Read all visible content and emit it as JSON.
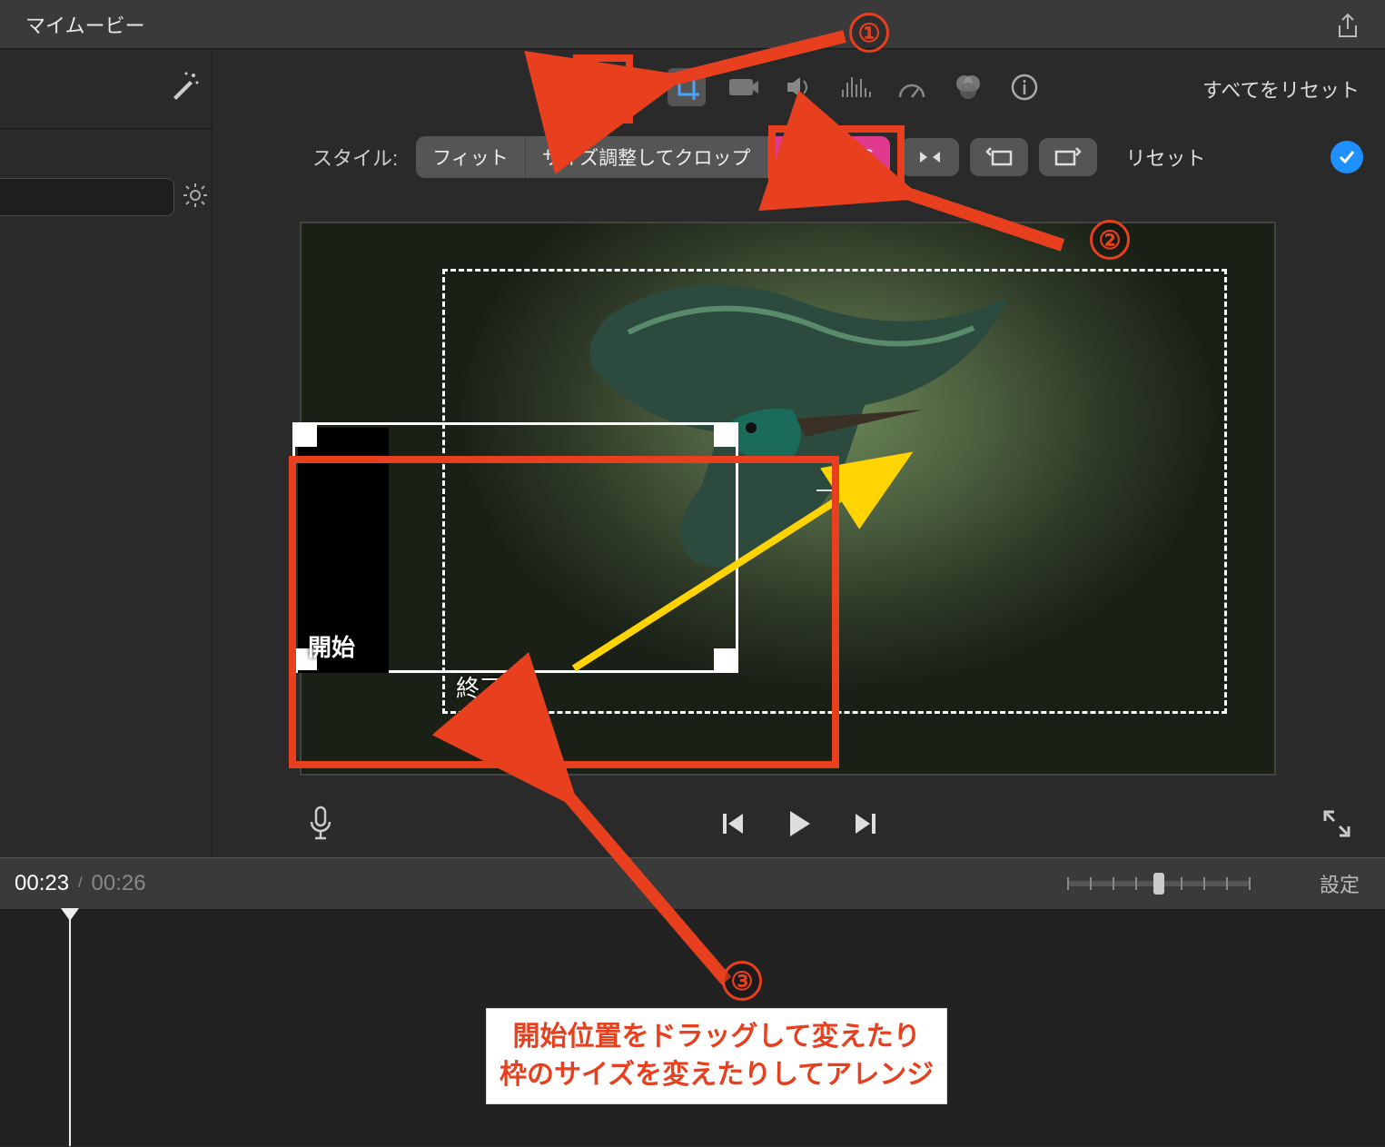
{
  "titlebar": {
    "title": "マイムービー"
  },
  "inspector": {
    "reset_all": "すべてをリセット",
    "style_label": "スタイル:",
    "fit": "フィット",
    "crop": "サイズ調整してクロップ",
    "ken_burns": "Ken Burns",
    "reset": "リセット"
  },
  "kenburns": {
    "start_label": "開始",
    "end_label": "終了"
  },
  "timeline": {
    "current": "00:23",
    "separator": "/",
    "duration": "00:26",
    "settings": "設定"
  },
  "annotations": {
    "n1": "①",
    "n2": "②",
    "n3": "③",
    "callout_l1": "開始位置をドラッグして変えたり",
    "callout_l2": "枠のサイズを変えたりしてアレンジ"
  }
}
